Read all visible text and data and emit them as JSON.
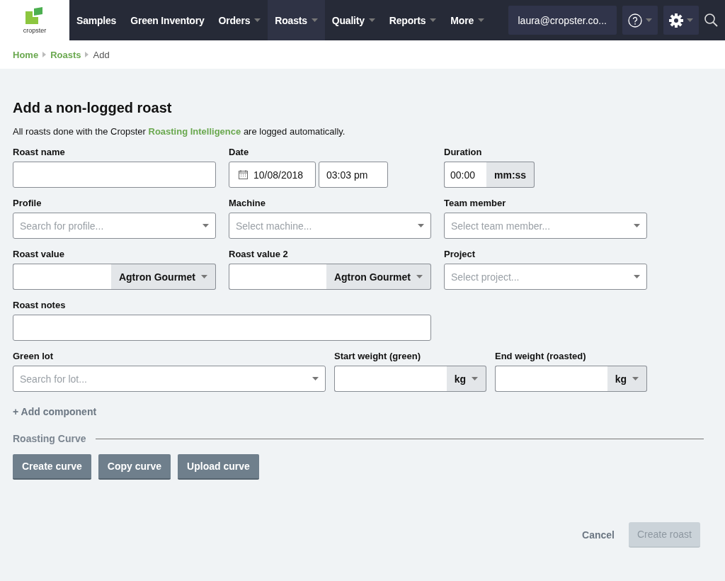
{
  "nav": {
    "logo": "cropster",
    "items": [
      {
        "label": "Samples",
        "dropdown": false,
        "selected": false
      },
      {
        "label": "Green Inventory",
        "dropdown": false,
        "selected": false
      },
      {
        "label": "Orders",
        "dropdown": true,
        "selected": false
      },
      {
        "label": "Roasts",
        "dropdown": true,
        "selected": true
      },
      {
        "label": "Quality",
        "dropdown": true,
        "selected": false
      },
      {
        "label": "Reports",
        "dropdown": true,
        "selected": false
      },
      {
        "label": "More",
        "dropdown": true,
        "selected": false
      }
    ],
    "user": "laura@cropster.co..."
  },
  "breadcrumb": [
    {
      "label": "Home",
      "kind": "link"
    },
    {
      "label": "Roasts",
      "kind": "link"
    },
    {
      "label": "Add",
      "kind": "current"
    }
  ],
  "title": "Add a non-logged roast",
  "intro": {
    "before": "All roasts done with the Cropster",
    "link": "Roasting Intelligence",
    "after": "are logged automatically."
  },
  "rows": [
    [
      {
        "kind": "text",
        "label": "Roast name"
      },
      {
        "kind": "date",
        "label": "Date",
        "value": "10/08/2018",
        "time": "03:03 pm"
      },
      {
        "kind": "duration",
        "label": "Duration",
        "value": "00:00",
        "unit": "mm:ss"
      }
    ],
    [
      {
        "kind": "select",
        "label": "Profile",
        "placeholder": "Search for profile..."
      },
      {
        "kind": "select",
        "label": "Machine",
        "placeholder": "Select machine..."
      },
      {
        "kind": "select",
        "label": "Team member",
        "placeholder": "Select team member..."
      }
    ],
    [
      {
        "kind": "unit",
        "label": "Roast value",
        "unit": "Agtron Gourmet"
      },
      {
        "kind": "unit",
        "label": "Roast value 2",
        "unit": "Agtron Gourmet"
      },
      {
        "kind": "select",
        "label": "Project",
        "placeholder": "Select project..."
      }
    ],
    [
      {
        "kind": "wide",
        "label": "Roast notes"
      }
    ],
    [
      {
        "kind": "select",
        "label": "Green lot",
        "placeholder": "Search for lot..."
      },
      {
        "kind": "unit",
        "label": "Start weight (green)",
        "unit": "kg"
      },
      {
        "kind": "unit",
        "label": "End weight (roasted)",
        "unit": "kg"
      }
    ]
  ],
  "add_component": "+ Add component",
  "curve": {
    "title": "Roasting Curve",
    "buttons": [
      "Create curve",
      "Copy curve",
      "Upload curve"
    ]
  },
  "footer": {
    "cancel": "Cancel",
    "submit": {
      "label": "Create roast",
      "disabled": true
    }
  }
}
